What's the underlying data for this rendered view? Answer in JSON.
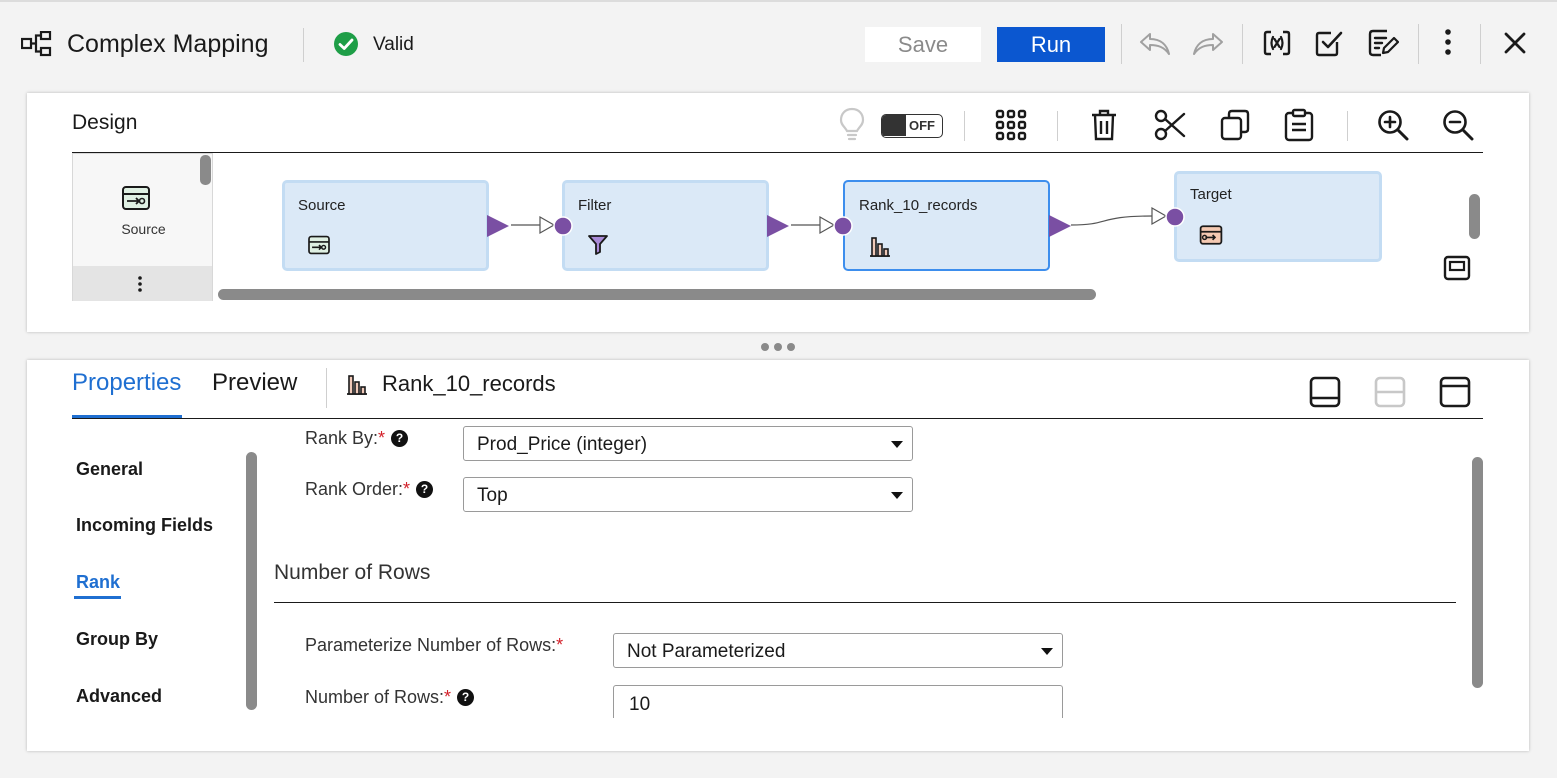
{
  "header": {
    "title": "Complex Mapping",
    "status": "Valid",
    "save_label": "Save",
    "run_label": "Run"
  },
  "design": {
    "title": "Design",
    "toggle_label": "OFF",
    "palette": {
      "item_label": "Source"
    },
    "nodes": [
      {
        "label": "Source"
      },
      {
        "label": "Filter"
      },
      {
        "label": "Rank_10_records"
      },
      {
        "label": "Target"
      }
    ]
  },
  "properties": {
    "tabs": {
      "properties": "Properties",
      "preview": "Preview"
    },
    "object_name": "Rank_10_records",
    "nav": [
      "General",
      "Incoming Fields",
      "Rank",
      "Group By",
      "Advanced"
    ],
    "fields": {
      "rank_by": {
        "label": "Rank By:",
        "required": "*",
        "value": "Prod_Price (integer)"
      },
      "rank_order": {
        "label": "Rank Order:",
        "required": "*",
        "value": "Top"
      },
      "section_title": "Number of Rows",
      "parameterize": {
        "label": "Parameterize Number of Rows:",
        "required": "*",
        "value": "Not Parameterized"
      },
      "num_rows": {
        "label": "Number of Rows:",
        "required": "*",
        "value": "10"
      }
    }
  },
  "colors": {
    "accent": "#0b57d0",
    "link": "#1f6fd1",
    "valid": "#1e9e47",
    "node_fill": "#dbe9f7",
    "port": "#7a4fa3"
  }
}
